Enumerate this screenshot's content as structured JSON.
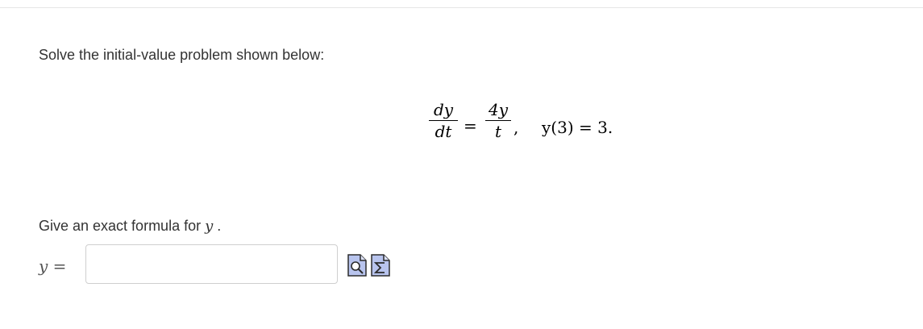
{
  "question": {
    "prompt": "Solve the initial-value problem shown below:",
    "equation": {
      "lhs_numerator": "dy",
      "lhs_denominator": "dt",
      "equals": "=",
      "rhs_numerator": "4y",
      "rhs_denominator": "t",
      "comma": ",",
      "condition": "y(3) = 3."
    },
    "formula_prompt": "Give an exact formula for",
    "formula_var": "y",
    "formula_end": "."
  },
  "answer": {
    "label": "y =",
    "value": "",
    "placeholder": ""
  },
  "tools": {
    "preview_icon": "preview-icon",
    "equation_editor_icon": "equation-editor-icon"
  }
}
